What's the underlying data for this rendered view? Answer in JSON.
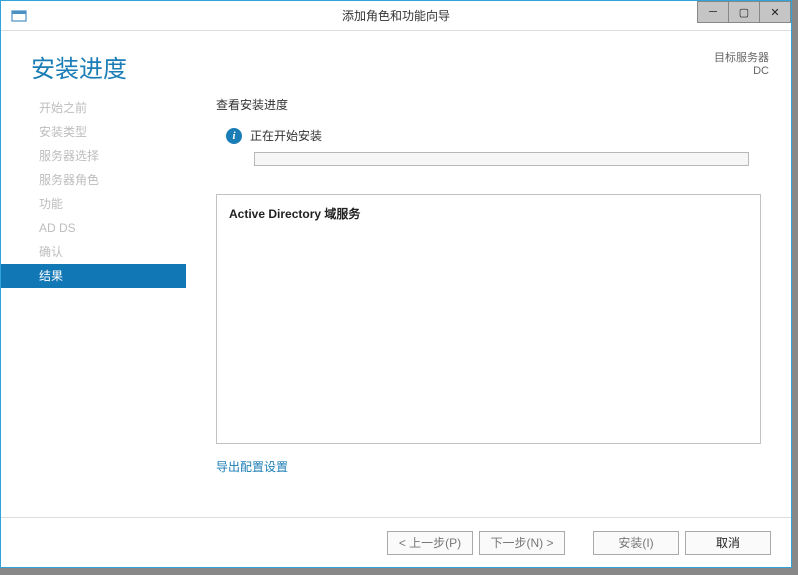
{
  "window": {
    "title": "添加角色和功能向导"
  },
  "header": {
    "page_title": "安装进度",
    "target_label": "目标服务器",
    "target_value": "DC"
  },
  "sidebar": {
    "items": [
      {
        "label": "开始之前",
        "active": false
      },
      {
        "label": "安装类型",
        "active": false
      },
      {
        "label": "服务器选择",
        "active": false
      },
      {
        "label": "服务器角色",
        "active": false
      },
      {
        "label": "功能",
        "active": false
      },
      {
        "label": "AD DS",
        "active": false
      },
      {
        "label": "确认",
        "active": false
      },
      {
        "label": "结果",
        "active": true
      }
    ]
  },
  "main": {
    "subtitle": "查看安装进度",
    "status_text": "正在开始安装",
    "details_title": "Active Directory 域服务",
    "export_link": "导出配置设置"
  },
  "buttons": {
    "prev": "< 上一步(P)",
    "next": "下一步(N) >",
    "install": "安装(I)",
    "cancel": "取消"
  }
}
